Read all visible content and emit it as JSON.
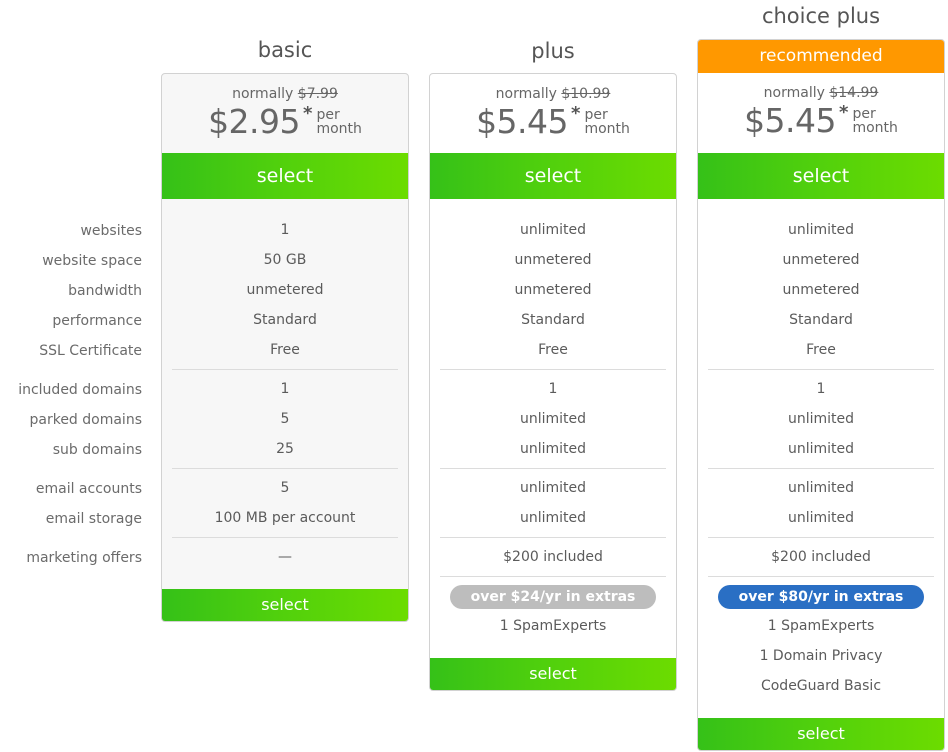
{
  "labels": [
    "websites",
    "website space",
    "bandwidth",
    "performance",
    "SSL Certificate",
    "included domains",
    "parked domains",
    "sub domains",
    "email accounts",
    "email storage",
    "marketing offers"
  ],
  "plans": [
    {
      "name": "basic",
      "normally_label": "normally",
      "old_price": "$7.99",
      "price": "$2.95",
      "asterisk": "*",
      "per": "per",
      "month": "month",
      "select_label": "select",
      "values": [
        "1",
        "50 GB",
        "unmetered",
        "Standard",
        "Free",
        "1",
        "5",
        "25",
        "5",
        "100 MB per account",
        "—"
      ],
      "extras_badge": null,
      "extras": [],
      "bottom_select_label": "select"
    },
    {
      "name": "plus",
      "normally_label": "normally",
      "old_price": "$10.99",
      "price": "$5.45",
      "asterisk": "*",
      "per": "per",
      "month": "month",
      "select_label": "select",
      "values": [
        "unlimited",
        "unmetered",
        "unmetered",
        "Standard",
        "Free",
        "1",
        "unlimited",
        "unlimited",
        "unlimited",
        "unlimited",
        "$200 included"
      ],
      "extras_badge": "over $24/yr in extras",
      "extras_badge_color": "#bdbdbd",
      "extras": [
        "1 SpamExperts"
      ],
      "bottom_select_label": "select"
    },
    {
      "name": "choice plus",
      "recommended_label": "recommended",
      "recommended_color": "#ff9800",
      "normally_label": "normally",
      "old_price": "$14.99",
      "price": "$5.45",
      "asterisk": "*",
      "per": "per",
      "month": "month",
      "select_label": "select",
      "values": [
        "unlimited",
        "unmetered",
        "unmetered",
        "Standard",
        "Free",
        "1",
        "unlimited",
        "unlimited",
        "unlimited",
        "unlimited",
        "$200 included"
      ],
      "extras_badge": "over $80/yr in extras",
      "extras_badge_color": "#2a6fc4",
      "extras": [
        "1 SpamExperts",
        "1 Domain Privacy",
        "CodeGuard Basic"
      ],
      "bottom_select_label": "select"
    }
  ],
  "colors": {
    "select_green_start": "#35c118",
    "select_green_end": "#6cdc00",
    "recommended_orange": "#ff9800",
    "extras_blue": "#2a6fc4",
    "extras_gray": "#bdbdbd"
  }
}
